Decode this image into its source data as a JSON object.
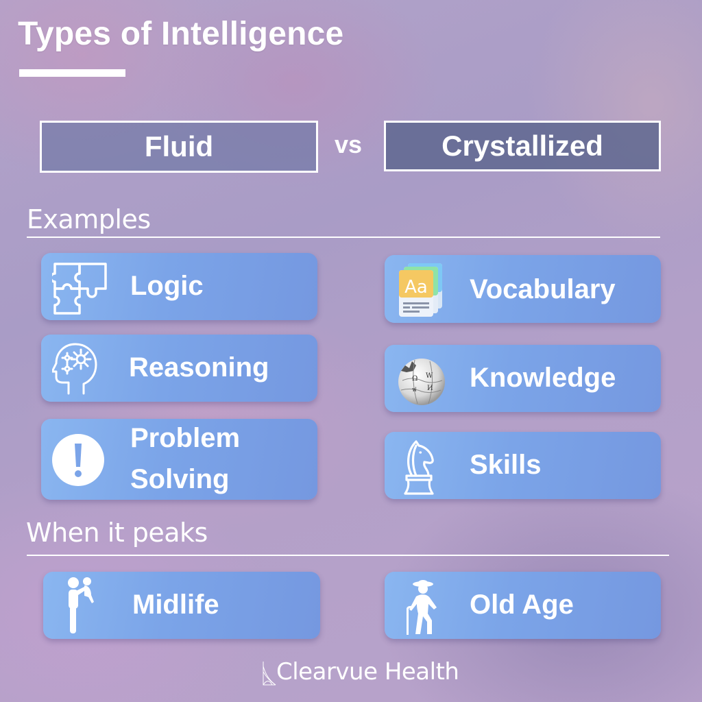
{
  "header": {
    "title": "Types of Intelligence"
  },
  "comparison": {
    "left": "Fluid",
    "separator": "vs",
    "right": "Crystallized"
  },
  "sections": {
    "examples": {
      "label": "Examples"
    },
    "peaks": {
      "label": "When it peaks"
    }
  },
  "fluid": {
    "examples": [
      {
        "label": "Logic",
        "icon": "puzzle-icon"
      },
      {
        "label": "Reasoning",
        "icon": "head-gears-icon"
      },
      {
        "label_line1": "Problem",
        "label_line2": "Solving",
        "icon": "exclamation-icon"
      }
    ],
    "peak": {
      "label": "Midlife",
      "icon": "parent-child-icon"
    }
  },
  "crystallized": {
    "examples": [
      {
        "label": "Vocabulary",
        "icon": "dictionary-icon"
      },
      {
        "label": "Knowledge",
        "icon": "wikipedia-globe-icon"
      },
      {
        "label": "Skills",
        "icon": "chess-knight-icon"
      }
    ],
    "peak": {
      "label": "Old Age",
      "icon": "elderly-person-icon"
    }
  },
  "footer": {
    "brand": "Clearvue Health"
  },
  "colors": {
    "card_gradient_start": "#8ab6f0",
    "card_gradient_end": "#7598e0",
    "box_fill": "#5f6e9b",
    "text": "#ffffff",
    "dictionary_yellow": "#f5c862",
    "dictionary_green": "#8fe3a8",
    "dictionary_blue": "#7ec8f5"
  }
}
